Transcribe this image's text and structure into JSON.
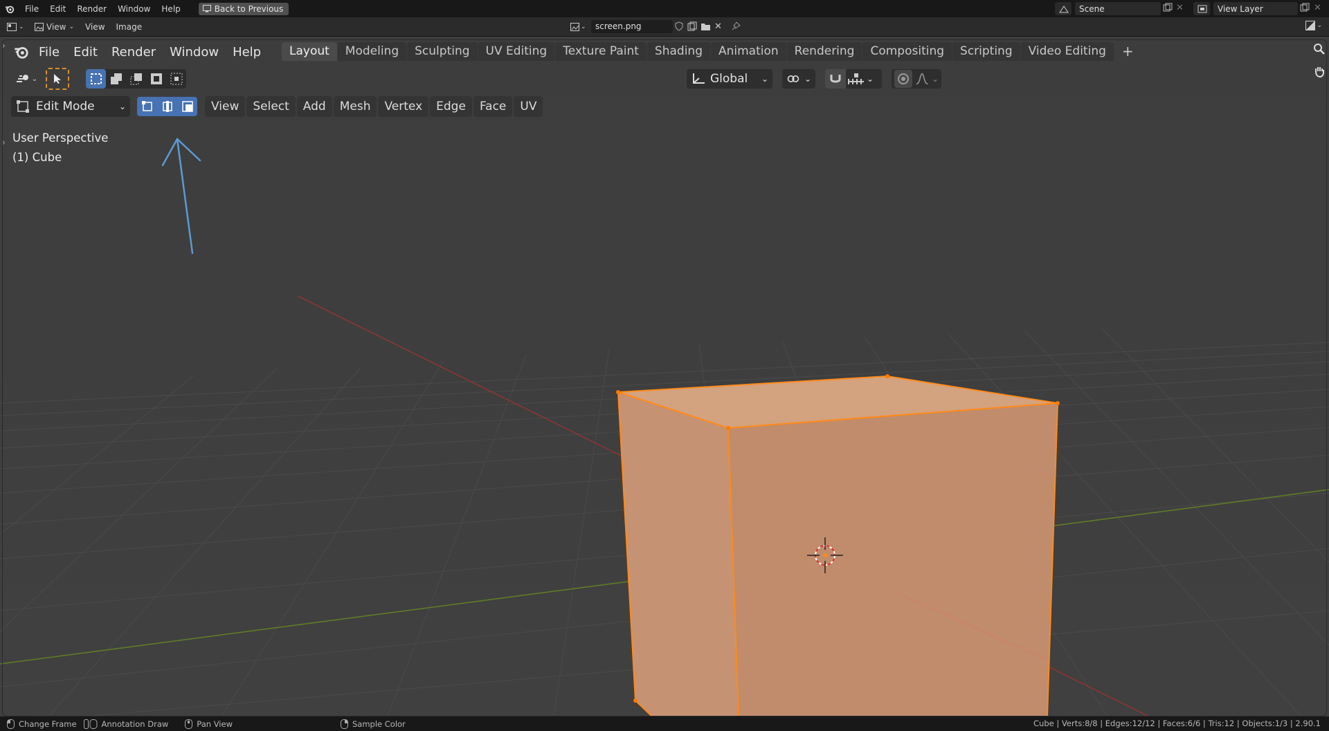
{
  "topbar": {
    "menus": [
      "File",
      "Edit",
      "Render",
      "Window",
      "Help"
    ],
    "back_button": "Back to Previous",
    "scene_label": "Scene",
    "view_layer_label": "View Layer"
  },
  "image_editor": {
    "menus": [
      "View",
      "Image"
    ],
    "view_dropdown": "View",
    "filename": "screen.png"
  },
  "viewport": {
    "menus": [
      "File",
      "Edit",
      "Render",
      "Window",
      "Help"
    ],
    "workspace_tabs": [
      {
        "label": "Layout",
        "active": true
      },
      {
        "label": "Modeling"
      },
      {
        "label": "Sculpting"
      },
      {
        "label": "UV Editing"
      },
      {
        "label": "Texture Paint"
      },
      {
        "label": "Shading"
      },
      {
        "label": "Animation"
      },
      {
        "label": "Rendering"
      },
      {
        "label": "Compositing"
      },
      {
        "label": "Scripting"
      },
      {
        "label": "Video Editing"
      }
    ],
    "add_tab": "+",
    "mode": "Edit Mode",
    "edit_menus": [
      "View",
      "Select",
      "Add",
      "Mesh",
      "Vertex",
      "Edge",
      "Face",
      "UV"
    ],
    "orientation": "Global",
    "overlay_line1": "User Perspective",
    "overlay_line2": "(1) Cube",
    "selection_mode_active": [
      "vertex",
      "edge",
      "face"
    ]
  },
  "statusbar": {
    "items": [
      "Change Frame",
      "Annotation Draw",
      "Pan View",
      "Sample Color"
    ],
    "stats": "Cube | Verts:8/8 | Edges:12/12 | Faces:6/6 | Tris:12 | Objects:1/3 | 2.90.1"
  },
  "colors": {
    "selected_mesh": "#c39072",
    "selected_edge": "#ff8c1a",
    "accent_blue": "#4772b3",
    "annotation_arrow": "#5b9bd5",
    "axis_x": "#9e3a3a",
    "axis_y": "#6f8f2c"
  }
}
